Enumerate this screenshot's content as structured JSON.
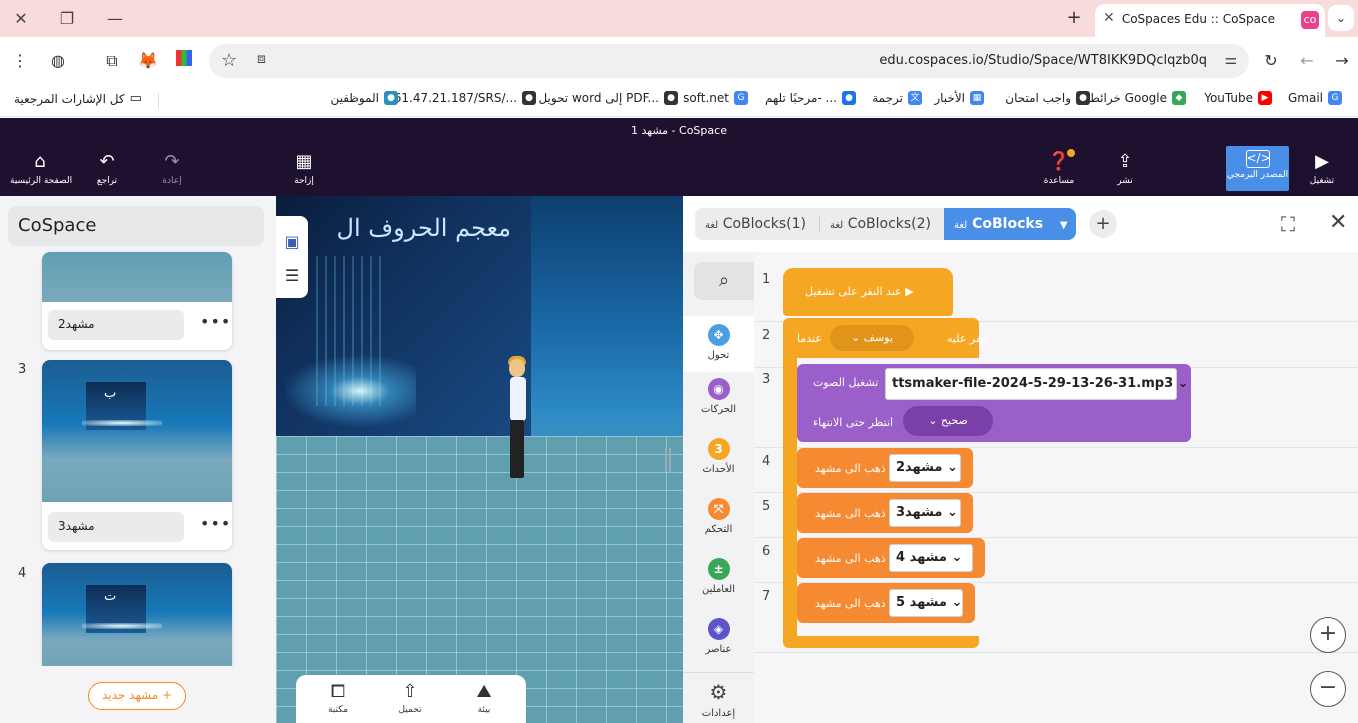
{
  "browser": {
    "tab_title": "CoSpaces Edu :: CoSpace",
    "url": "edu.cospaces.io/Studio/Space/WT8IKK9DQclqzb0q",
    "bookmarks": [
      {
        "label": "Gmail",
        "icon": "G",
        "color": "#4285f4"
      },
      {
        "label": "YouTube",
        "icon": "▶",
        "color": "#ff0000"
      },
      {
        "label": "خرائط Google",
        "icon": "◆",
        "color": "#34a853"
      },
      {
        "label": "واجب امتحان",
        "icon": "●",
        "color": "#333333"
      },
      {
        "label": "الأخبار",
        "icon": "▦",
        "color": "#4285f4"
      },
      {
        "label": "ترجمة",
        "icon": "文",
        "color": "#4285f4"
      },
      {
        "label": "مرحبًا تلهم- ...",
        "icon": "●",
        "color": "#1a73e8"
      },
      {
        "label": "soft.net",
        "icon": "G",
        "color": "#4285f4"
      },
      {
        "label": "تحويل word إلى PDF...",
        "icon": "●",
        "color": "#333333"
      },
      {
        "label": "161.47.21.187/SRS/...",
        "icon": "●",
        "color": "#333333"
      },
      {
        "label": "الموظفين",
        "icon": "●",
        "color": "#2a8fbd"
      }
    ],
    "all_bookmarks": "كل الإشارات المرجعية"
  },
  "app": {
    "scene_title": "مشهد 1 - CoSpace",
    "home": "الصفحة الرئيسية",
    "undo": "تراجع",
    "redo": "إعادة",
    "move": "إزاحة",
    "help": "مساعدة",
    "share": "نشر",
    "code": "المصدر البرمجي",
    "play": "تشغيل"
  },
  "left_panel": {
    "space_name": "CoSpace",
    "scenes": [
      {
        "num": "",
        "name": "مشهد2",
        "letter": ""
      },
      {
        "num": "3",
        "name": "مشهد3",
        "letter": "ب"
      },
      {
        "num": "4",
        "name": "",
        "letter": "ت"
      }
    ],
    "new_scene": "مشهد جديد +"
  },
  "viewport": {
    "board_text": "معجم الحروف ال",
    "tool_1": "image-icon",
    "tool_2": "list-icon",
    "bottom": [
      {
        "label": "مكتبة",
        "icon": "library-icon"
      },
      {
        "label": "تحميل",
        "icon": "upload-icon"
      },
      {
        "label": "بيئة",
        "icon": "environment-icon"
      }
    ]
  },
  "code_panel": {
    "tabs": [
      {
        "label": "CoBlocks",
        "prefix": "لغة"
      },
      {
        "label": "CoBlocks(2)",
        "prefix": "لغة"
      },
      {
        "label": "CoBlocks(1)",
        "prefix": "لغة"
      }
    ],
    "categories": [
      {
        "label": "تحول",
        "icon": "✥",
        "color": "#4a9fe0"
      },
      {
        "label": "الحركات",
        "icon": "◉",
        "color": "#9b5fc9"
      },
      {
        "label": "الأحداث",
        "icon": "3",
        "color": "#f5a623"
      },
      {
        "label": "التحكم",
        "icon": "⤧",
        "color": "#f58a33"
      },
      {
        "label": "العاملين",
        "icon": "±",
        "color": "#3aa657"
      },
      {
        "label": "عناصر",
        "icon": "◈",
        "color": "#5b55c8"
      }
    ],
    "settings": "إعدادات",
    "line_numbers": [
      "1",
      "2",
      "3",
      "4",
      "5",
      "6",
      "7"
    ],
    "blocks": {
      "on_play": "عند النقر على تشغيل",
      "when": "عندما",
      "who": "يوسف",
      "clicked": "ينقر عليه",
      "play_sound": "تشغيل الصوت",
      "sound_file": "ttsmaker-file-2024-5-29-13-26-31.mp3",
      "wait_end": "انتظر حتى الانتهاء",
      "wait_value": "صحيح",
      "go_to": "ذهب الى مشهد",
      "targets": [
        "مشهد2",
        "مشهد3",
        "مشهد 4",
        "مشهد 5"
      ]
    }
  }
}
